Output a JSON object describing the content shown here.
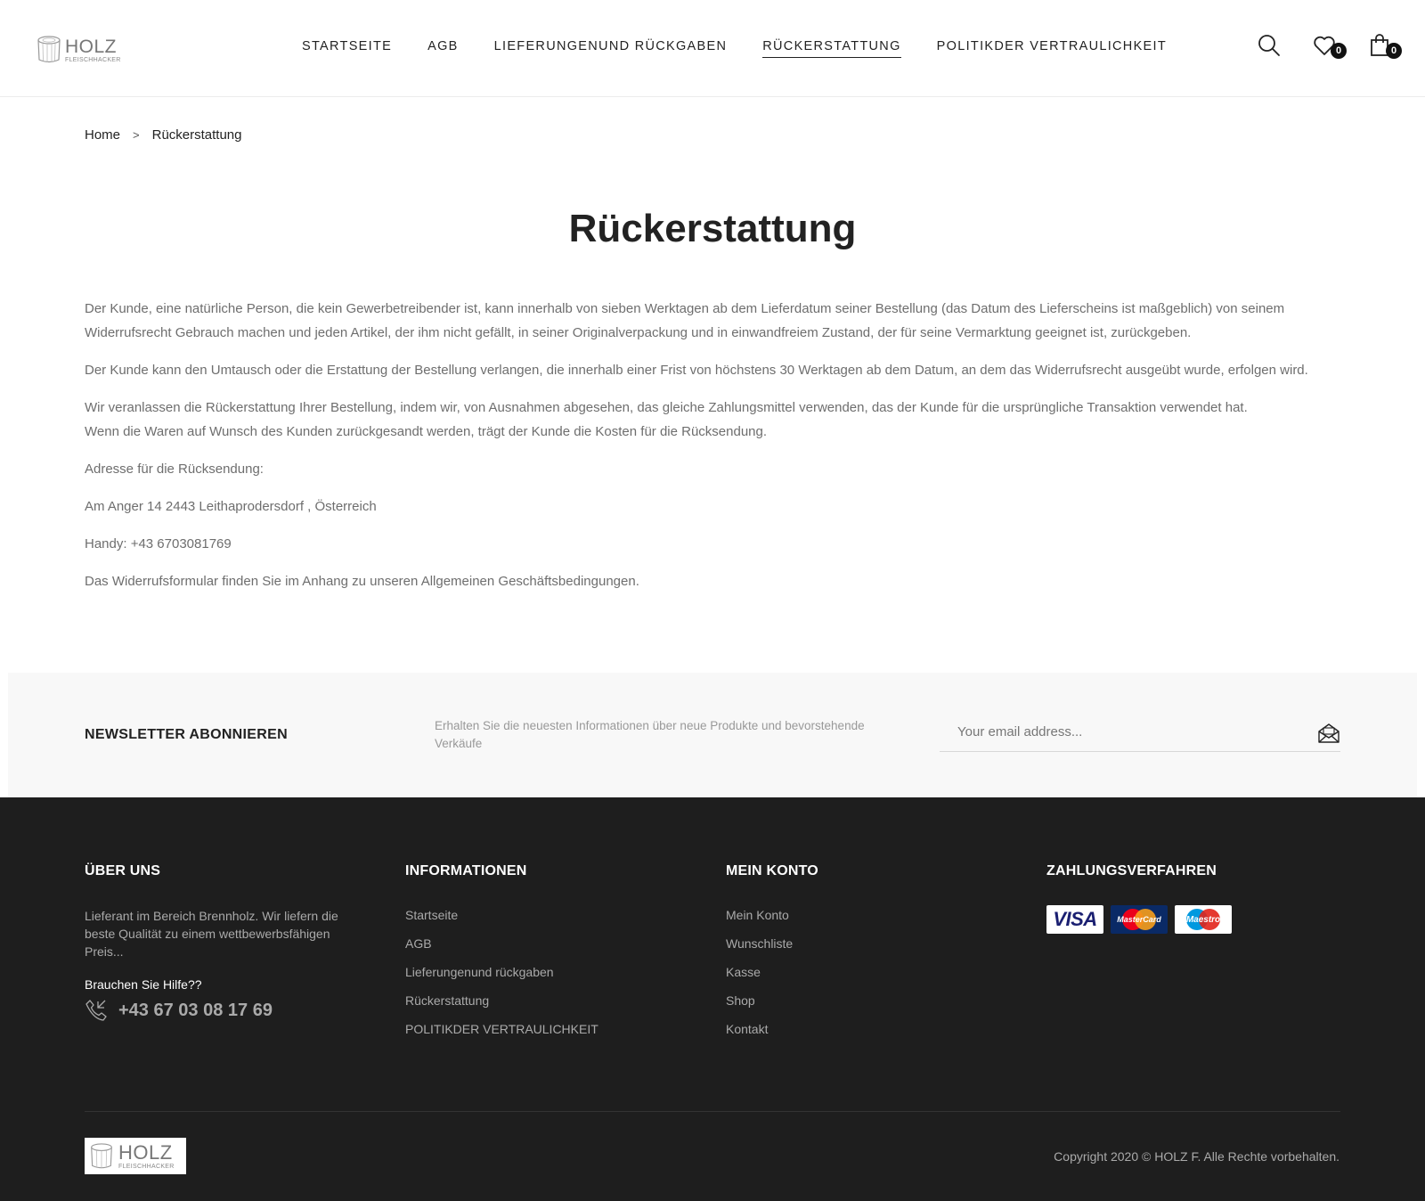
{
  "header": {
    "logo": {
      "brand": "HOLZ",
      "tagline": "FLEISCHHACKER"
    },
    "nav": [
      {
        "label": "STARTSEITE",
        "active": false
      },
      {
        "label": "AGB",
        "active": false
      },
      {
        "label": "LIEFERUNGENUND RÜCKGABEN",
        "active": false
      },
      {
        "label": "RÜCKERSTATTUNG",
        "active": true
      },
      {
        "label": "POLITIKDER VERTRAULICHKEIT",
        "active": false
      }
    ],
    "wishlist_count": "0",
    "cart_count": "0"
  },
  "breadcrumb": {
    "home": "Home",
    "separator": ">",
    "current": "Rückerstattung"
  },
  "page": {
    "title": "Rückerstattung",
    "paragraphs": [
      "Der Kunde, eine natürliche Person, die kein Gewerbetreibender ist, kann innerhalb von sieben Werktagen ab dem Lieferdatum seiner Bestellung (das Datum des Lieferscheins ist maßgeblich) von seinem Widerrufsrecht Gebrauch machen und jeden Artikel, der ihm nicht gefällt, in seiner Originalverpackung und in einwandfreiem Zustand, der für seine Vermarktung geeignet ist, zurückgeben.",
      "Der Kunde kann den Umtausch oder die Erstattung der Bestellung verlangen, die innerhalb einer Frist von höchstens 30 Werktagen ab dem Datum, an dem das Widerrufsrecht ausgeübt wurde, erfolgen wird.",
      "Wir veranlassen die Rückerstattung Ihrer Bestellung, indem wir, von Ausnahmen abgesehen, das gleiche Zahlungsmittel verwenden, das der Kunde für die ursprüngliche Transaktion verwendet hat.",
      "Wenn die Waren auf Wunsch des Kunden zurückgesandt werden, trägt der Kunde die Kosten für die Rücksendung.",
      "Adresse für die Rücksendung:",
      "Am Anger 14 2443 Leithaprodersdorf , Österreich",
      "Handy: +43 6703081769",
      "Das Widerrufsformular finden Sie im Anhang zu unseren Allgemeinen Geschäftsbedingungen."
    ]
  },
  "newsletter": {
    "title": "NEWSLETTER ABONNIEREN",
    "description": "Erhalten Sie die neuesten Informationen über neue Produkte und bevorstehende Verkäufe",
    "placeholder": "Your email address..."
  },
  "footer": {
    "about": {
      "heading": "ÜBER UNS",
      "text": "Lieferant im Bereich Brennholz. Wir liefern die beste Qualität zu einem wettbewerbsfähigen Preis...",
      "help": "Brauchen Sie Hilfe??",
      "phone": "+43 67 03 08 17 69"
    },
    "info": {
      "heading": "INFORMATIONEN",
      "links": [
        "Startseite",
        "AGB",
        "Lieferungenund rückgaben",
        "Rückerstattung",
        "POLITIKDER VERTRAULICHKEIT"
      ]
    },
    "account": {
      "heading": "MEIN KONTO",
      "links": [
        "Mein Konto",
        "Wunschliste",
        "Kasse",
        "Shop",
        "Kontakt"
      ]
    },
    "payment": {
      "heading": "ZAHLUNGSVERFAHREN",
      "cards": [
        "VISA",
        "MasterCard",
        "Maestro"
      ]
    },
    "copyright": "Copyright 2020 © HOLZ F. Alle Rechte vorbehalten."
  },
  "colors": {
    "footer_bg": "#1e1e1e",
    "newsletter_bg": "#f8f8f8",
    "visa_blue": "#1a1f71",
    "mastercard_red": "#eb001b",
    "mastercard_orange": "#f79e1b",
    "maestro_blue": "#0099df"
  }
}
